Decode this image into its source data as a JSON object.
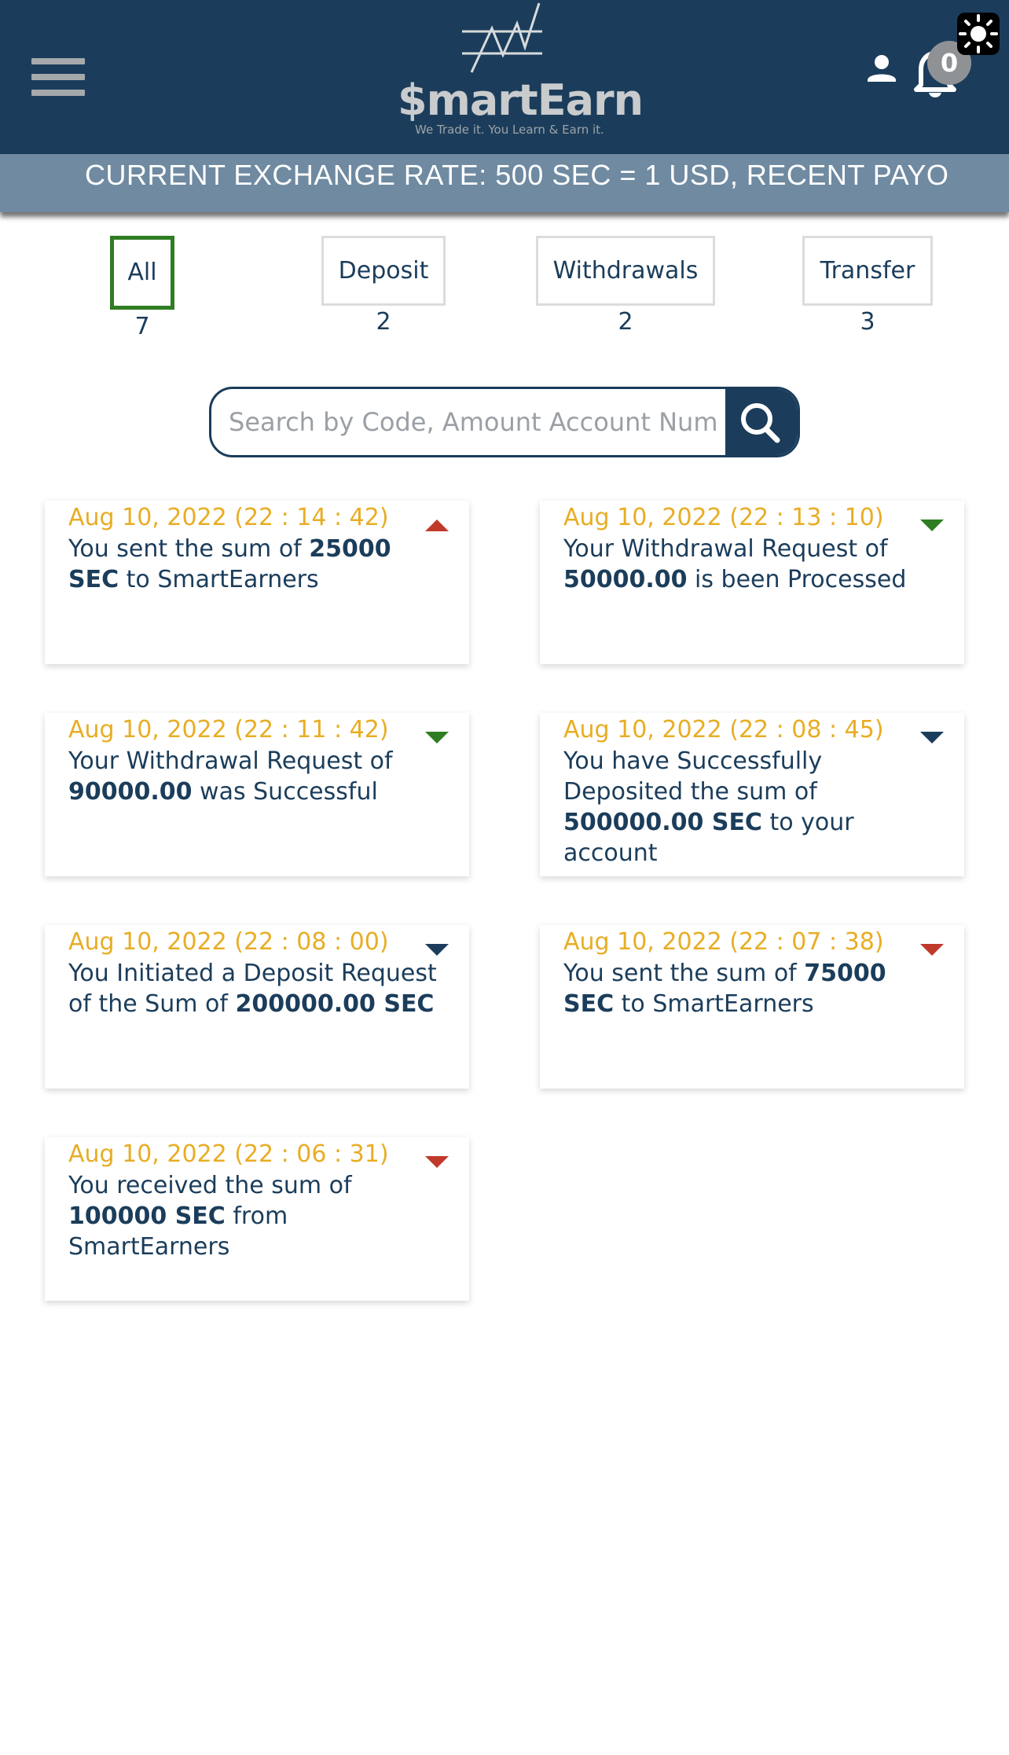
{
  "header": {
    "logo_text": "$martEarn",
    "logo_tagline": "We Trade it. You Learn & Earn it.",
    "notification_count": "0"
  },
  "ticker": {
    "text": "CURRENT EXCHANGE RATE: 500 SEC = 1 USD, RECENT PAYO"
  },
  "tabs": [
    {
      "label": "All",
      "count": "7",
      "active": true
    },
    {
      "label": "Deposit",
      "count": "2",
      "active": false
    },
    {
      "label": "Withdrawals",
      "count": "2",
      "active": false
    },
    {
      "label": "Transfer",
      "count": "3",
      "active": false
    }
  ],
  "search": {
    "placeholder": "Search by Code, Amount Account Number"
  },
  "transactions": [
    {
      "date": "Aug 10, 2022 (22 : 14 : 42)",
      "pre": "You sent the sum of ",
      "bold": "25000 SEC",
      "post": " to SmartEarners",
      "arrow": "up",
      "arrow_color": "#c0392b"
    },
    {
      "date": "Aug 10, 2022 (22 : 13 : 10)",
      "pre": "Your Withdrawal Request of ",
      "bold": "50000.00",
      "post": " is been Processed",
      "arrow": "down",
      "arrow_color": "#2f7d22"
    },
    {
      "date": "Aug 10, 2022 (22 : 11 : 42)",
      "pre": "Your Withdrawal Request of ",
      "bold": "90000.00",
      "post": " was Successful",
      "arrow": "down",
      "arrow_color": "#2f7d22"
    },
    {
      "date": "Aug 10, 2022 (22 : 08 : 45)",
      "pre": "You have Successfully Deposited the sum of ",
      "bold": "500000.00 SEC",
      "post": " to your account",
      "arrow": "down",
      "arrow_color": "#1b3d5b"
    },
    {
      "date": "Aug 10, 2022 (22 : 08 : 00)",
      "pre": "You Initiated a Deposit Request of the Sum of ",
      "bold": "200000.00 SEC",
      "post": "",
      "arrow": "down",
      "arrow_color": "#1b3d5b"
    },
    {
      "date": "Aug 10, 2022 (22 : 07 : 38)",
      "pre": "You sent the sum of ",
      "bold": "75000 SEC",
      "post": " to SmartEarners",
      "arrow": "down",
      "arrow_color": "#c0392b"
    },
    {
      "date": "Aug 10, 2022 (22 : 06 : 31)",
      "pre": "You received the sum of ",
      "bold": "100000 SEC",
      "post": " from SmartEarners",
      "arrow": "down",
      "arrow_color": "#c0392b"
    }
  ],
  "colors": {
    "header_bg": "#1b3d5b",
    "ticker_bg": "#6f8aa1",
    "date_text": "#e8ad24",
    "active_tab_border": "#2f7d22"
  },
  "icons": [
    "menu-icon",
    "chart-logo-icon",
    "user-icon",
    "bell-icon",
    "brightness-icon",
    "search-icon",
    "arrow-up-icon",
    "arrow-down-icon"
  ]
}
